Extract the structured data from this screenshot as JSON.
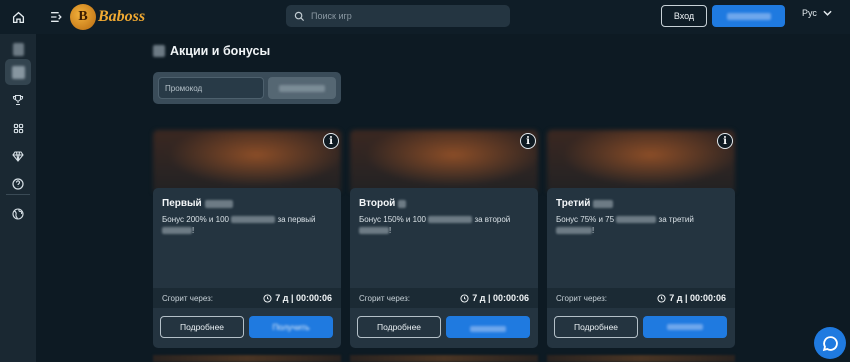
{
  "header": {
    "logo_text": "Baboss",
    "logo_letter": "B",
    "search_placeholder": "Поиск игр",
    "login_label": "Вход",
    "language": "Рус"
  },
  "sidebar": {
    "icons": [
      "home-icon",
      "trophy-icon",
      "grid-icon",
      "diamond-icon",
      "help-icon",
      "globe-icon"
    ]
  },
  "page": {
    "title": "Акции и бонусы",
    "promo_placeholder": "Промокод"
  },
  "cards": [
    {
      "title": "Первый",
      "desc_a": "Бонус 200% и 100",
      "desc_b": "за первый",
      "desc_c": "!",
      "expire_label": "Сгорит через:",
      "expire_time": "7 д | 00:00:06",
      "more_label": "Подробнее",
      "get_label": "Получить"
    },
    {
      "title": "Второй",
      "desc_a": "Бонус 150% и 100",
      "desc_b": "за второй",
      "desc_c": "!",
      "expire_label": "Сгорит через:",
      "expire_time": "7 д | 00:00:06",
      "more_label": "Подробнее",
      "get_label": ""
    },
    {
      "title": "Третий",
      "desc_a": "Бонус 75% и 75",
      "desc_b": "за третий",
      "desc_c": "!",
      "expire_label": "Сгорит через:",
      "expire_time": "7 д | 00:00:06",
      "more_label": "Подробнее",
      "get_label": ""
    }
  ],
  "colors": {
    "accent": "#1f7ae0",
    "background": "#0d1a23",
    "card": "#243440",
    "logo": "#f0a932"
  }
}
